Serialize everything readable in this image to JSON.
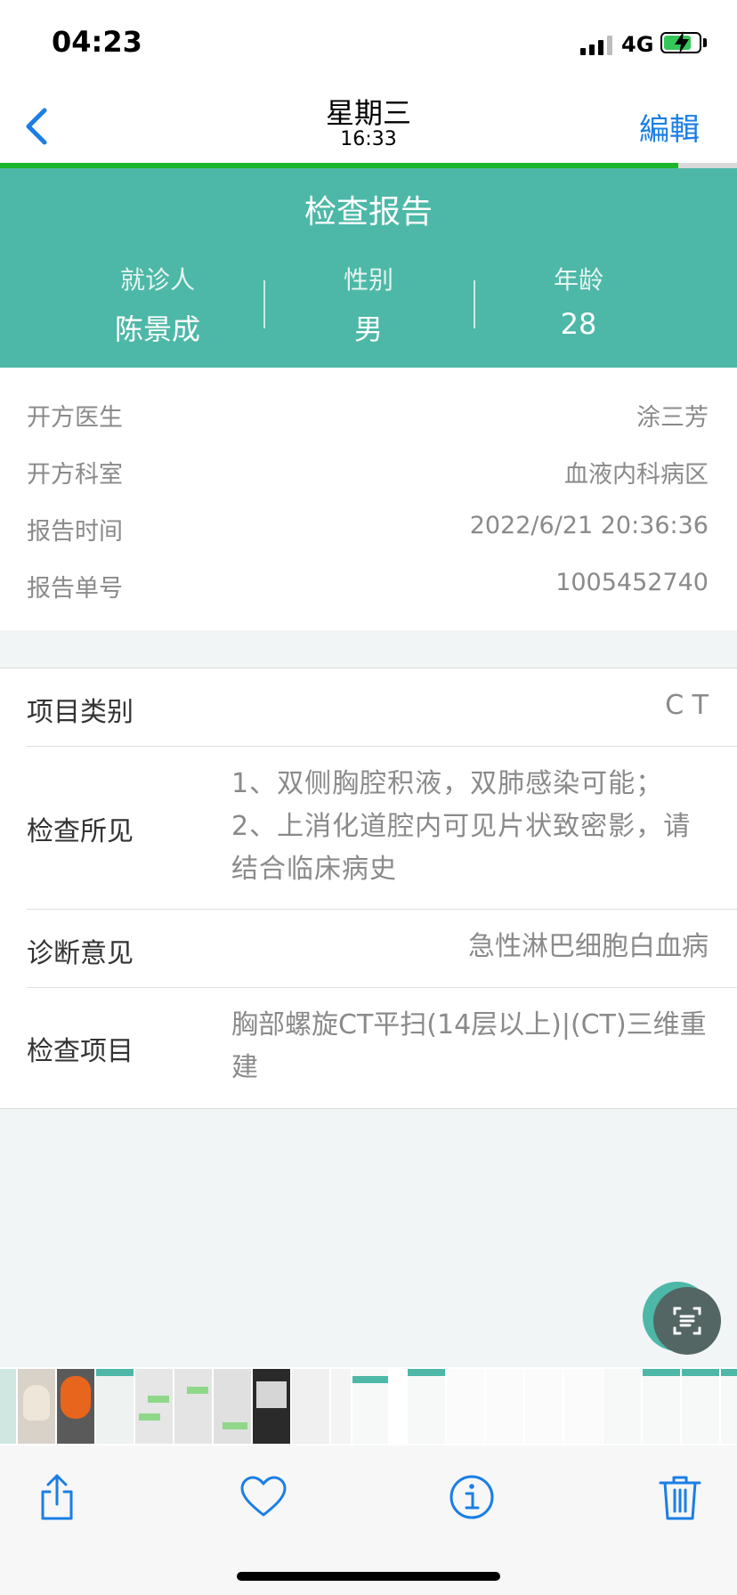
{
  "status_bar": {
    "time": "04:23",
    "network": "4G"
  },
  "nav": {
    "title": "星期三",
    "subtitle": "16:33",
    "edit_label": "編輯"
  },
  "page": {
    "load_progress": 0.92
  },
  "report": {
    "title": "检查报告",
    "patient": [
      {
        "label": "就诊人",
        "value": "陈景成"
      },
      {
        "label": "性别",
        "value": "男"
      },
      {
        "label": "年龄",
        "value": "28"
      }
    ],
    "info": [
      {
        "label": "开方医生",
        "value": "涂三芳"
      },
      {
        "label": "开方科室",
        "value": "血液内科病区"
      },
      {
        "label": "报告时间",
        "value": "2022/6/21 20:36:36"
      },
      {
        "label": "报告单号",
        "value": "1005452740"
      }
    ],
    "details": [
      {
        "label": "项目类别",
        "value": "C T"
      },
      {
        "label": "检查所见",
        "value": "1、双侧胸腔积液，双肺感染可能； 2、上消化道腔内可见片状致密影，请结合临床病史"
      },
      {
        "label": "诊断意见",
        "value": "急性淋巴细胞白血病"
      },
      {
        "label": "检查项目",
        "value": "胸部螺旋CT平扫(14层以上)|(CT)三维重建"
      }
    ]
  },
  "icons": {
    "back": "chevron-left-icon",
    "scan": "scan-icon",
    "share": "share-icon",
    "favorite": "heart-icon",
    "info": "info-icon",
    "delete": "trash-icon"
  },
  "colors": {
    "accent": "#1a7ee6",
    "header": "#4db8a7",
    "progress": "#1db52b"
  }
}
